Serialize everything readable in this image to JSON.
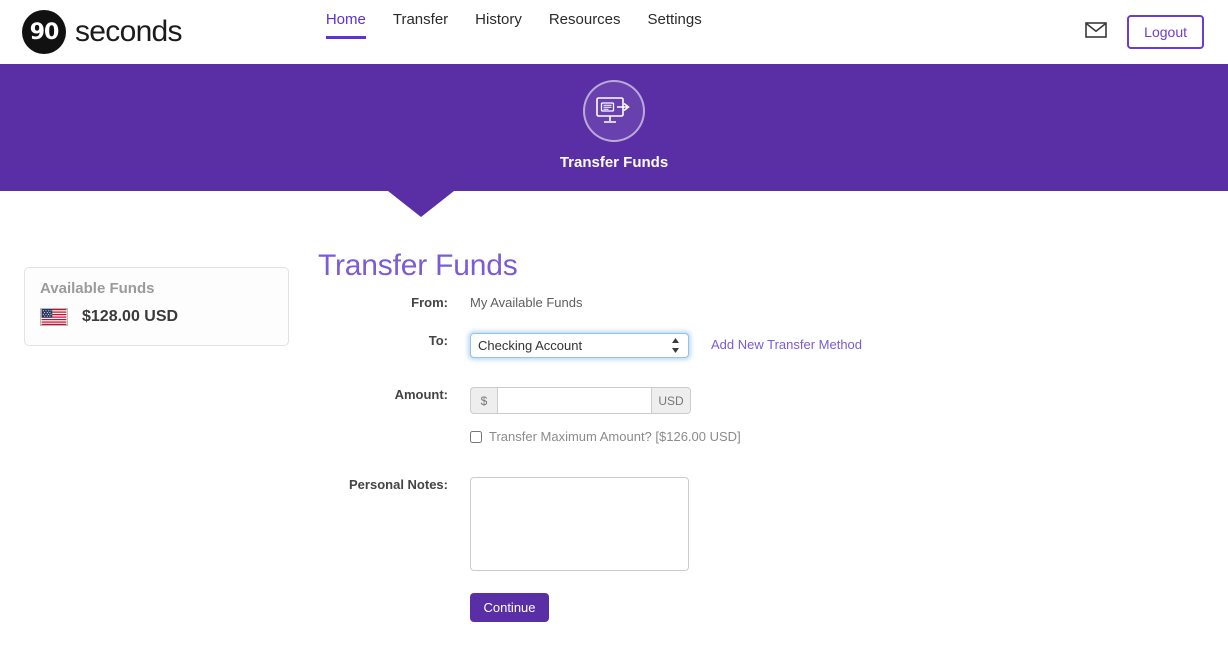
{
  "brand": {
    "logo_mark": "90",
    "logo_text": "seconds",
    "logo_icon": "ninety-seconds-logo-icon"
  },
  "nav": {
    "items": [
      {
        "label": "Home",
        "active": true
      },
      {
        "label": "Transfer",
        "active": false
      },
      {
        "label": "History",
        "active": false
      },
      {
        "label": "Resources",
        "active": false
      },
      {
        "label": "Settings",
        "active": false
      }
    ]
  },
  "header_actions": {
    "mail_icon": "envelope-icon",
    "logout_label": "Logout"
  },
  "banner": {
    "icon": "money-transfer-screen-icon",
    "title": "Transfer Funds"
  },
  "sidebar": {
    "card_title": "Available Funds",
    "flag_icon": "us-flag-icon",
    "amount": "$128.00 USD"
  },
  "main": {
    "page_title": "Transfer Funds",
    "from": {
      "label": "From:",
      "value": "My Available Funds"
    },
    "to": {
      "label": "To:",
      "selected": "Checking Account",
      "options": [
        "Checking Account"
      ],
      "add_method_link": "Add New Transfer Method"
    },
    "amount": {
      "label": "Amount:",
      "prefix": "$",
      "suffix": "USD",
      "value": "",
      "placeholder": ""
    },
    "max_amount": {
      "label": "Transfer Maximum Amount? [$126.00 USD]",
      "checked": false
    },
    "notes": {
      "label": "Personal Notes:",
      "value": "",
      "placeholder": ""
    },
    "submit_label": "Continue"
  },
  "colors": {
    "banner_purple": "#5A2FA6",
    "accent_purple": "#5B32D6",
    "link_purple": "#7B5BD6",
    "focus_blue": "#93c3e8"
  }
}
